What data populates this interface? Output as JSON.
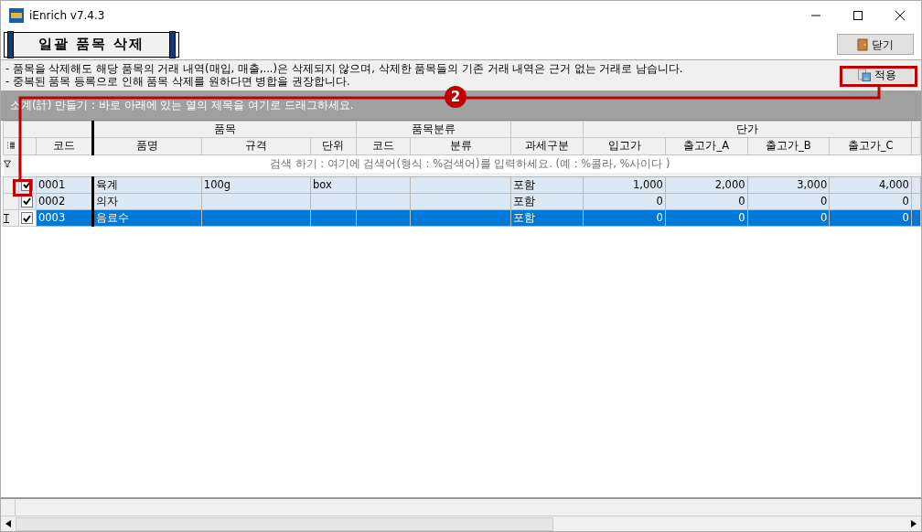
{
  "window": {
    "title": "iEnrich v7.4.3"
  },
  "page_title": "일괄 품목 삭제",
  "close_button": "닫기",
  "notes": [
    "- 품목을 삭제해도 해당 품목의 거래 내역(매입, 매출,...)은 삭제되지 않으며, 삭제한 품목들의 기존 거래 내역은 근거 없는 거래로 남습니다.",
    "- 중복된 품목 등록으로 인해 품목 삭제를 원하다면 병합을 권장합니다."
  ],
  "apply_button": "적용",
  "group_panel": "소계(計) 만들기 : 바로 아래에 있는 열의 제목을 여기로 드래그하세요.",
  "annotation": {
    "badge": "2"
  },
  "table": {
    "groups": [
      "품목",
      "품목분류",
      "단가"
    ],
    "columns": [
      "코드",
      "품명",
      "규격",
      "단위",
      "코드",
      "분류",
      "과세구분",
      "입고가",
      "출고가_A",
      "출고가_B",
      "출고가_C"
    ],
    "search_hint": "검색 하기 : 여기에 검색어(형식 : %검색어)를 입력하세요. (예 : %콜라, %사이다 )",
    "rows": [
      {
        "checked": true,
        "selected": false,
        "cells": [
          "0001",
          "육계",
          "100g",
          "box",
          "",
          "",
          "포함",
          "1,000",
          "2,000",
          "3,000",
          "4,000"
        ]
      },
      {
        "checked": true,
        "selected": false,
        "cells": [
          "0002",
          "의자",
          "",
          "",
          "",
          "",
          "포함",
          "0",
          "0",
          "0",
          "0"
        ]
      },
      {
        "checked": true,
        "selected": true,
        "cells": [
          "0003",
          "음료수",
          "",
          "",
          "",
          "",
          "포함",
          "0",
          "0",
          "0",
          "0"
        ]
      }
    ]
  }
}
